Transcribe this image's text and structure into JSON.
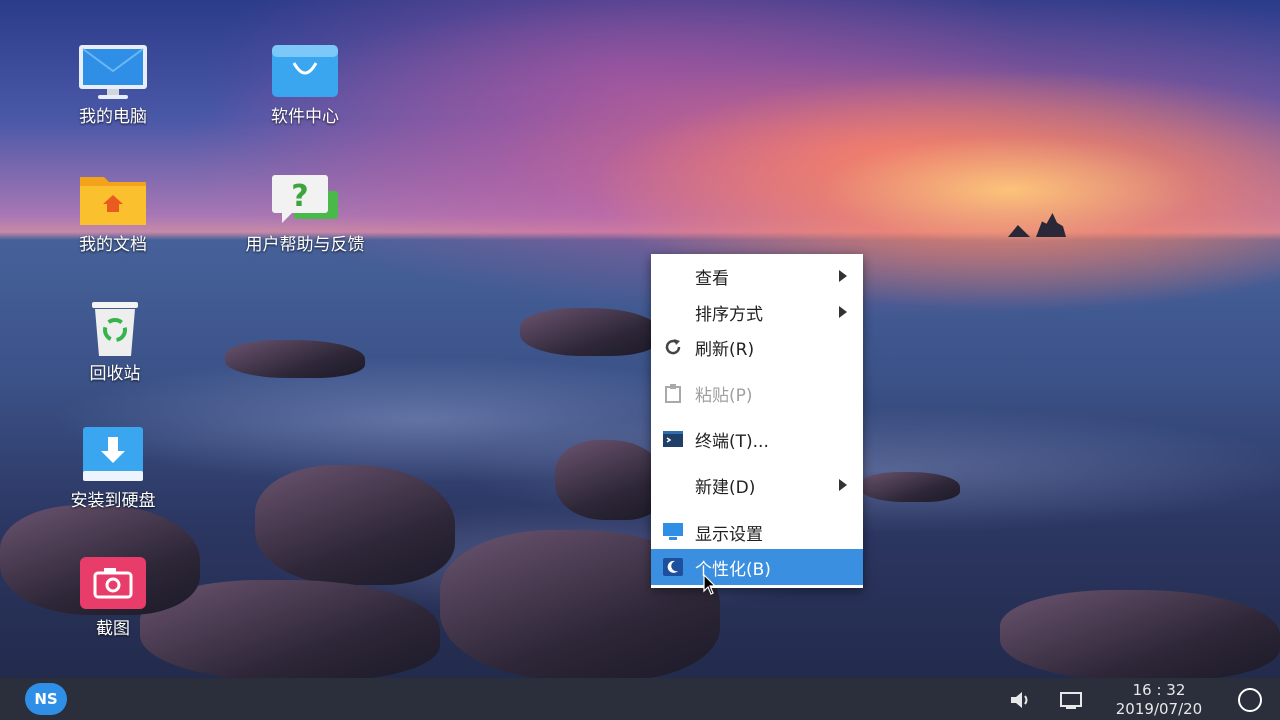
{
  "desktop": {
    "icons": [
      {
        "label": "我的电脑",
        "icon": "computer-icon"
      },
      {
        "label": "软件中心",
        "icon": "software-center-icon"
      },
      {
        "label": "我的文档",
        "icon": "documents-folder-icon"
      },
      {
        "label": "用户帮助与反馈",
        "icon": "help-feedback-icon"
      },
      {
        "label": "回收站",
        "icon": "recycle-bin-icon"
      },
      {
        "label": "安装到硬盘",
        "icon": "install-to-disk-icon"
      },
      {
        "label": "截图",
        "icon": "screenshot-icon"
      }
    ]
  },
  "context_menu": {
    "items": [
      {
        "label": "查看",
        "submenu": true
      },
      {
        "label": "排序方式",
        "submenu": true
      },
      {
        "label": "刷新(R)",
        "icon": "refresh-icon"
      },
      {
        "label": "粘贴(P)",
        "icon": "paste-icon",
        "disabled": true
      },
      {
        "label": "终端(T)...",
        "icon": "terminal-icon"
      },
      {
        "label": "新建(D)",
        "submenu": true
      },
      {
        "label": "显示设置",
        "icon": "display-settings-icon"
      },
      {
        "label": "个性化(B)",
        "icon": "personalize-icon",
        "highlighted": true
      }
    ],
    "highlight_color": "#3a8fe0"
  },
  "taskbar": {
    "start_label": "NS",
    "time": "16 : 32",
    "date": "2019/07/20",
    "tray_icons": [
      "volume-icon",
      "show-desktop-icon",
      "power-icon"
    ]
  }
}
